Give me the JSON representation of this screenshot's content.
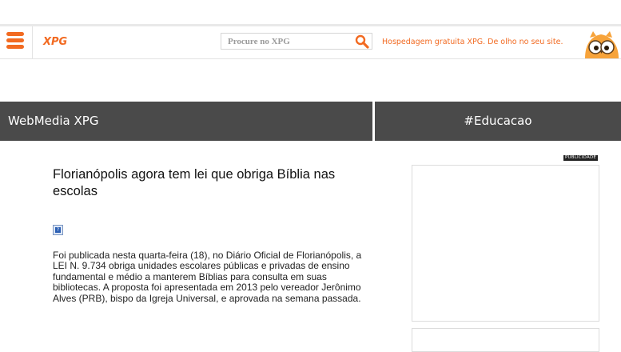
{
  "header": {
    "logo_text": "XPG",
    "search_placeholder": "Procure no XPG",
    "promo_text": "Hospedagem gratuita XPG. De olho no seu site.",
    "accent_color": "#f26a21"
  },
  "sections": {
    "left_title": "WebMedia XPG",
    "right_title": "#Educacao"
  },
  "article": {
    "title": "Florianópolis agora tem lei que obriga Bíblia nas escolas",
    "image_placeholder": "?",
    "body": "Foi publicada nesta quarta-feira (18), no Diário Oficial de Florianópolis, a LEI N. 9.734 obriga unidades escolares públicas e privadas de ensino fundamental e médio a manterem Bíblias para consulta em suas bibliotecas. A proposta foi apresentada em 2013 pelo vereador Jerônimo Alves (PRB), bispo da Igreja Universal, e aprovada na semana passada."
  },
  "sidebar": {
    "ad_label": "PUBLICIDADE"
  },
  "icons": {
    "menu": "hamburger-menu-icon",
    "search": "search-icon",
    "mascot": "owl-mascot-icon",
    "broken_image": "broken-image-icon"
  }
}
